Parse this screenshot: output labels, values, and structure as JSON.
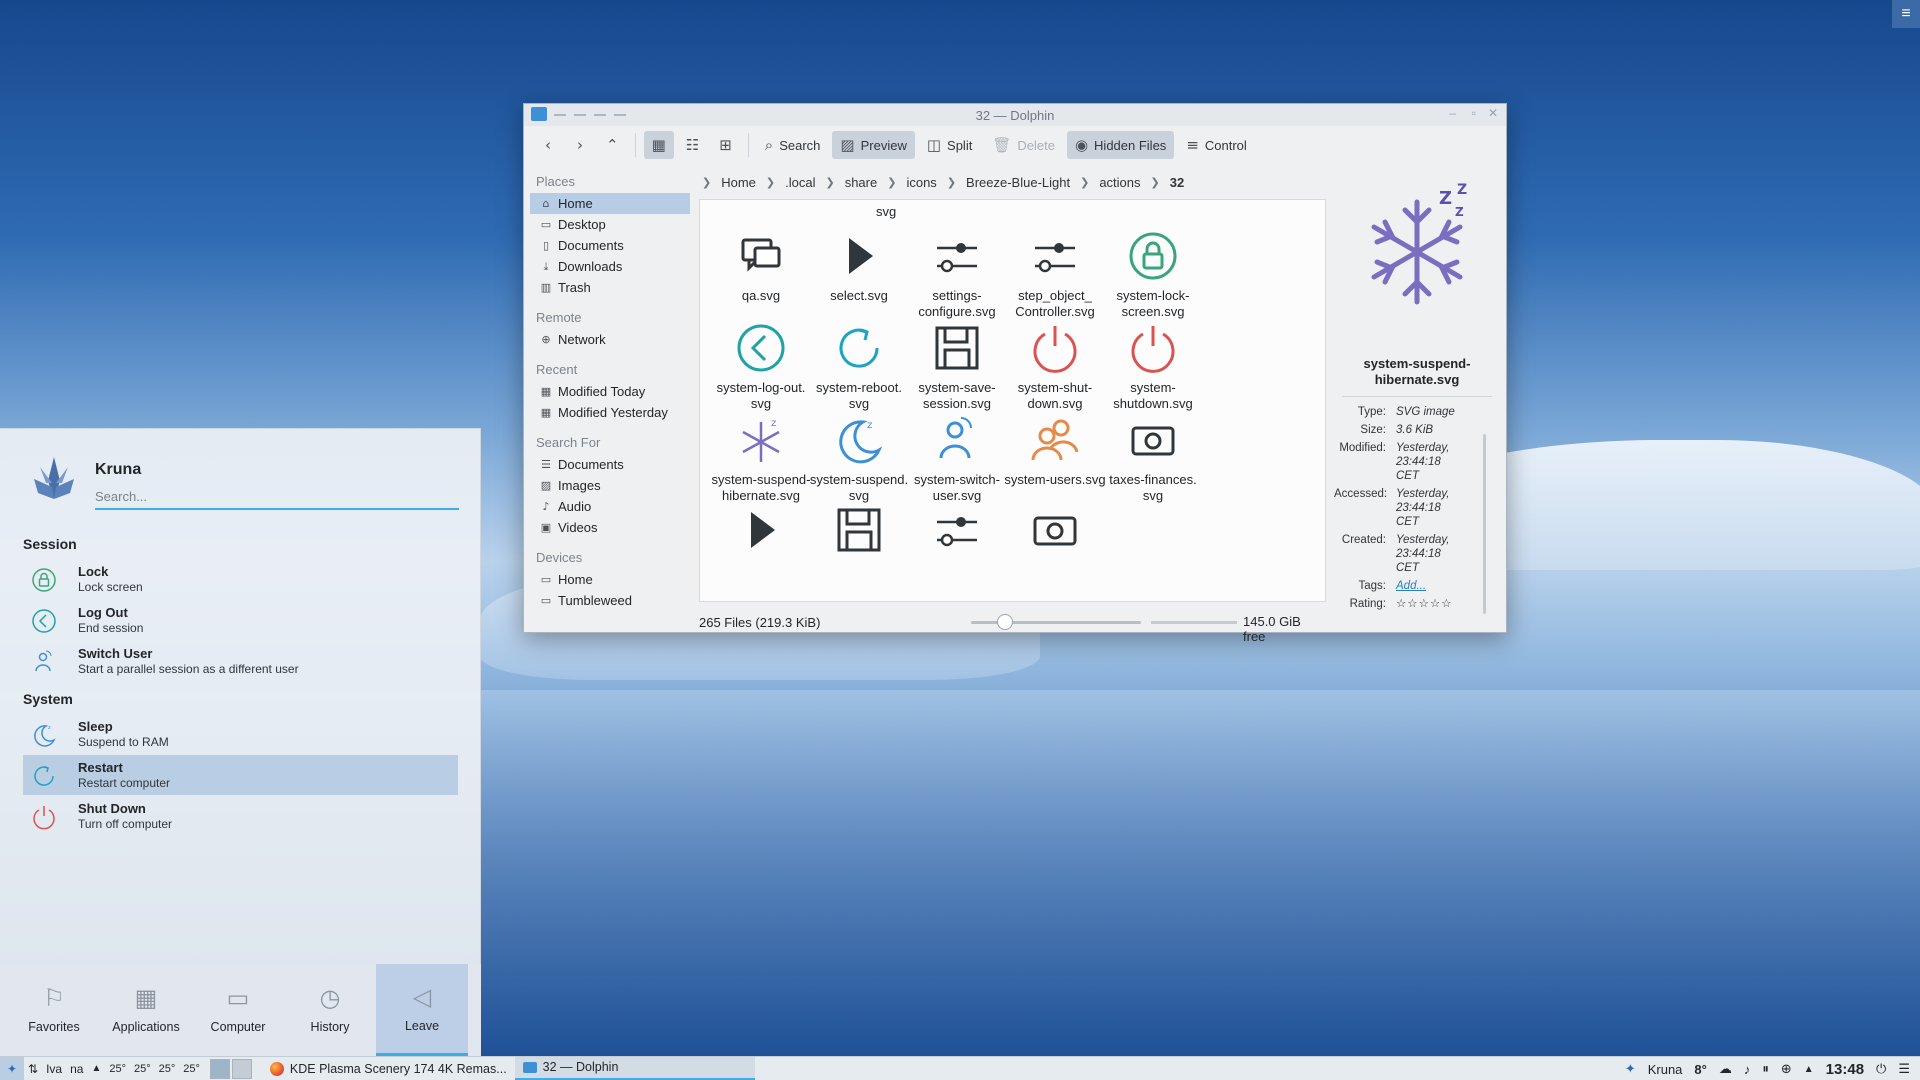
{
  "window": {
    "title": "32 — Dolphin",
    "toolbar": {
      "search": "Search",
      "preview": "Preview",
      "split": "Split",
      "delete": "Delete",
      "hidden_files": "Hidden Files",
      "control": "Control"
    },
    "places": {
      "places_header": "Places",
      "places": [
        "Home",
        "Desktop",
        "Documents",
        "Downloads",
        "Trash"
      ],
      "remote_header": "Remote",
      "remote": [
        "Network"
      ],
      "recent_header": "Recent",
      "recent": [
        "Modified Today",
        "Modified Yesterday"
      ],
      "search_header": "Search For",
      "search": [
        "Documents",
        "Images",
        "Audio",
        "Videos"
      ],
      "devices_header": "Devices",
      "devices": [
        "Home",
        "Tumbleweed"
      ]
    },
    "breadcrumb": [
      "Home",
      ".local",
      "share",
      "icons",
      "Breeze-Blue-Light",
      "actions",
      "32"
    ],
    "files_top_partial": "svg",
    "files": [
      {
        "name": "qa.svg",
        "icon": "chat-bubbles-icon"
      },
      {
        "name": "select.svg",
        "icon": "cursor-arrow-icon"
      },
      {
        "name": "settings-\nconfigure.svg",
        "icon": "sliders-icon"
      },
      {
        "name": "step_object_\nController.svg",
        "icon": "sliders-icon"
      },
      {
        "name": "system-lock-\nscreen.svg",
        "icon": "lock-icon",
        "color": "#3aa57a"
      },
      {
        "name": "system-log-out.\nsvg",
        "icon": "log-out-icon",
        "color": "#1ea3a6"
      },
      {
        "name": "system-reboot.\nsvg",
        "icon": "reboot-icon",
        "color": "#1ea3c3"
      },
      {
        "name": "system-save-\nsession.svg",
        "icon": "floppy-icon"
      },
      {
        "name": "system-shut-\ndown.svg",
        "icon": "power-icon",
        "color": "#d9534f"
      },
      {
        "name": "system-\nshutdown.svg",
        "icon": "power-icon",
        "color": "#d9534f"
      },
      {
        "name": "system-suspend-\nhibernate.svg",
        "icon": "snowflake-icon",
        "color": "#7b6ec0"
      },
      {
        "name": "system-suspend.\nsvg",
        "icon": "moon-icon",
        "color": "#3d8fd6"
      },
      {
        "name": "system-switch-\nuser.svg",
        "icon": "switch-user-icon",
        "color": "#3d8fd6"
      },
      {
        "name": "system-users.svg",
        "icon": "users-icon",
        "color": "#e58a4a"
      },
      {
        "name": "taxes-finances.\nsvg",
        "icon": "camera-icon"
      }
    ],
    "status": {
      "count": "265 Files (219.3 KiB)",
      "free": "145.0 GiB free",
      "zoom_level": 0.2
    },
    "info_panel": {
      "name": "system-suspend-\nhibernate.svg",
      "fields": [
        {
          "k": "Type:",
          "v": "SVG image"
        },
        {
          "k": "Size:",
          "v": "3.6 KiB"
        },
        {
          "k": "Modified:",
          "v": "Yesterday,\n23:44:18\nCET"
        },
        {
          "k": "Accessed:",
          "v": "Yesterday,\n23:44:18\nCET"
        },
        {
          "k": "Created:",
          "v": "Yesterday,\n23:44:18\nCET"
        },
        {
          "k": "Tags:",
          "v": "Add..."
        },
        {
          "k": "Rating:",
          "v": "☆☆☆☆☆"
        }
      ]
    }
  },
  "launcher": {
    "user": "Kruna",
    "search_placeholder": "Search...",
    "session_header": "Session",
    "system_header": "System",
    "session": [
      {
        "title": "Lock",
        "sub": "Lock screen",
        "icon": "lock-icon"
      },
      {
        "title": "Log Out",
        "sub": "End session",
        "icon": "log-out-icon"
      },
      {
        "title": "Switch User",
        "sub": "Start a parallel session as a different user",
        "icon": "switch-user-icon"
      }
    ],
    "system": [
      {
        "title": "Sleep",
        "sub": "Suspend to RAM",
        "icon": "moon-icon"
      },
      {
        "title": "Restart",
        "sub": "Restart computer",
        "icon": "reboot-icon"
      },
      {
        "title": "Shut Down",
        "sub": "Turn off computer",
        "icon": "power-icon"
      }
    ],
    "tabs": [
      "Favorites",
      "Applications",
      "Computer",
      "History",
      "Leave"
    ]
  },
  "taskbar": {
    "widgets": [
      "Iva",
      "na"
    ],
    "temps": [
      "25°",
      "25°",
      "25°",
      "25°"
    ],
    "tasks": [
      "KDE Plasma Scenery 174 4K Remas...",
      "32 — Dolphin"
    ],
    "tray_user": "Kruna",
    "weather": "8°",
    "clock": "13:48"
  },
  "colors": {
    "accent": "#3daee9",
    "selection": "#b7cde6"
  }
}
